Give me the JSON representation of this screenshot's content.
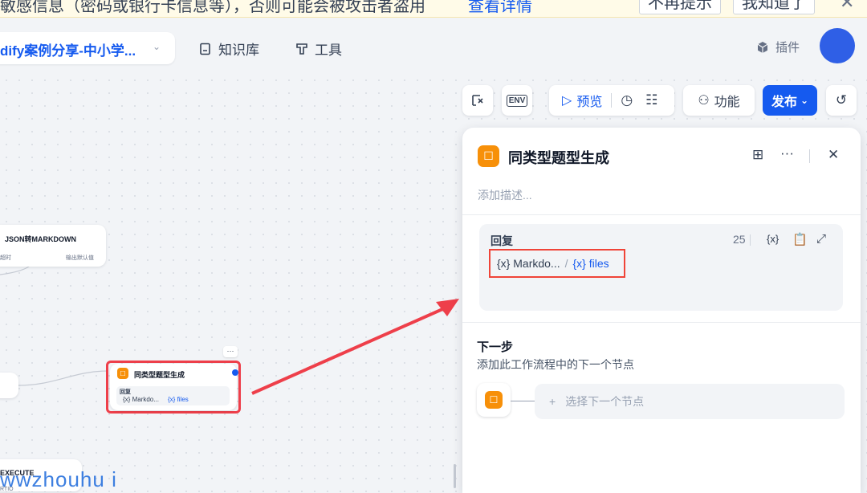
{
  "banner": {
    "text": "敏感信息（密码或银行卡信息等），否则可能会被攻击者盗用",
    "link": "查看详情",
    "dont_remind": "不再提示",
    "got_it": "我知道了",
    "close_icon": "close-icon"
  },
  "nav": {
    "app_name": "dify案例分享-中小学...",
    "knowledge": "知识库",
    "tools": "工具",
    "plugins": "插件"
  },
  "toolbar": {
    "env": "ENV",
    "preview": "预览",
    "features": "功能",
    "publish": "发布"
  },
  "canvas": {
    "json_node_title": "JSON转MARKDOWN",
    "json_node_left": "超时",
    "json_node_right": "输出默认值",
    "node_title": "同类型题型生成",
    "node_more": "···",
    "node_reply_label": "回复",
    "node_var_a": "Markdo...",
    "node_var_b": "files",
    "execute_label": "EXECUTE",
    "execute_sub": "RTIO"
  },
  "panel": {
    "title": "同类型题型生成",
    "desc_placeholder": "添加描述...",
    "reply": {
      "label": "回复",
      "count": "25",
      "var_a": "Markdo...",
      "var_sep": "/",
      "var_b": "files"
    },
    "next": {
      "title": "下一步",
      "desc": "添加此工作流程中的下一个节点",
      "select_placeholder": "选择下一个节点"
    }
  },
  "watermark": "wwzhouhu i",
  "colors": {
    "accent": "#155aef",
    "node_icon": "#f79009",
    "highlight": "#f04438",
    "avatar": "#2f5fe6"
  }
}
